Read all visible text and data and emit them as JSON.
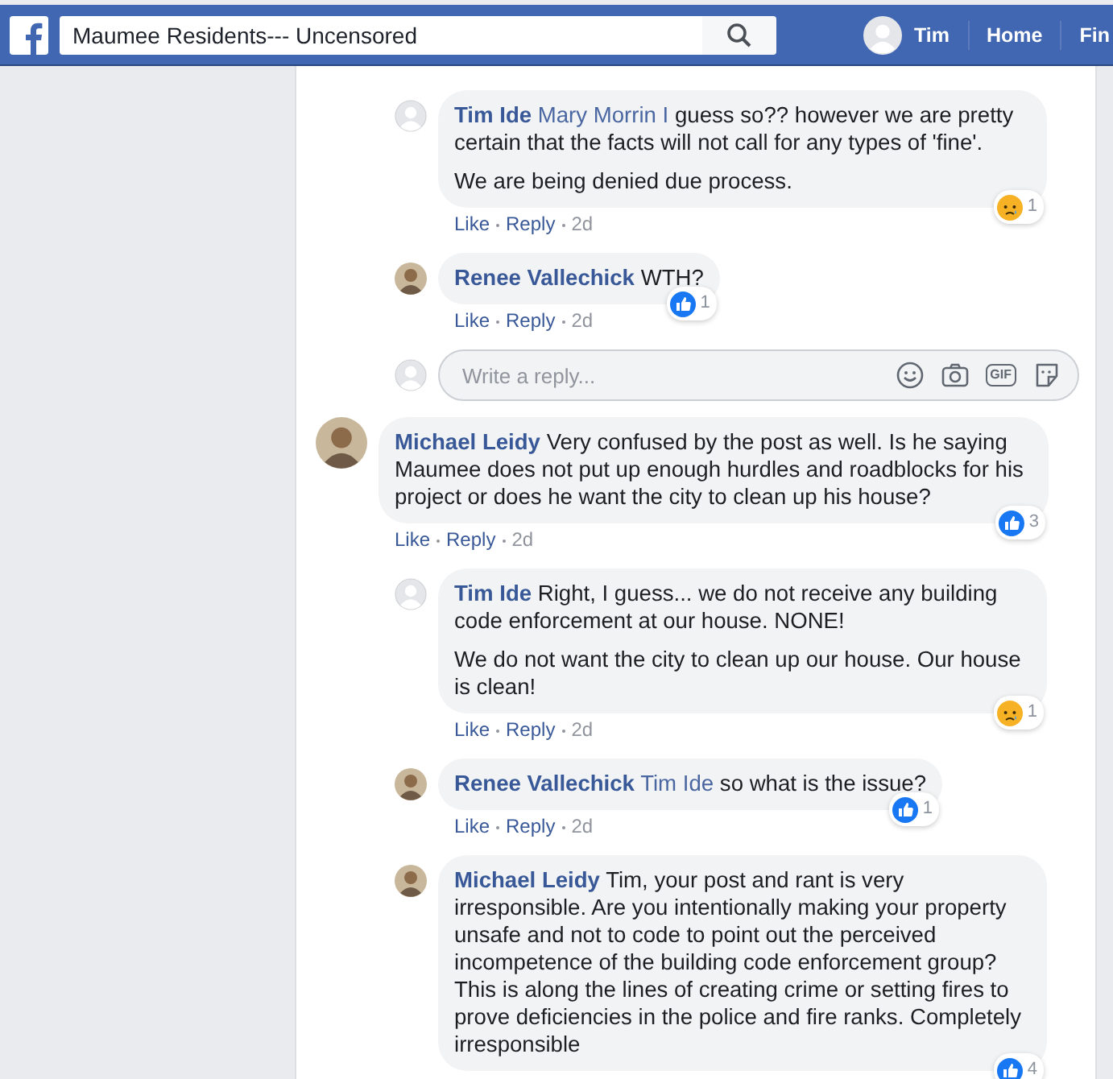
{
  "top_bar": {
    "search": {
      "value": "Maumee Residents--- Uncensored"
    },
    "user": "Tim",
    "nav": [
      "Home",
      "Fin"
    ]
  },
  "threads": [
    {
      "replies": [
        {
          "author": "Tim Ide",
          "has_photo": false,
          "mention": "Mary Morrin I",
          "paragraphs": [
            "guess so?? however we are pretty certain that the facts will not call for any types of 'fine'.",
            "We are being denied due process."
          ],
          "reaction": {
            "kind": "sad",
            "count": "1"
          },
          "meta": {
            "like": "Like",
            "reply": "Reply",
            "time": "2d"
          }
        },
        {
          "author": "Renee Vallechick",
          "has_photo": true,
          "paragraphs": [
            "WTH?"
          ],
          "reaction": {
            "kind": "like",
            "count": "1"
          },
          "meta": {
            "like": "Like",
            "reply": "Reply",
            "time": "2d"
          }
        }
      ],
      "reply_box": {
        "placeholder": "Write a reply...",
        "gif": "GIF"
      }
    },
    {
      "comment": {
        "author": "Michael Leidy",
        "has_photo": true,
        "paragraphs": [
          "Very confused by the post as well. Is he saying Maumee does not put up enough hurdles and roadblocks for his project or does he want the city to clean up his house?"
        ],
        "reaction": {
          "kind": "like",
          "count": "3"
        },
        "meta": {
          "like": "Like",
          "reply": "Reply",
          "time": "2d"
        }
      },
      "replies": [
        {
          "author": "Tim Ide",
          "has_photo": false,
          "paragraphs": [
            "Right, I guess... we do not receive any building code enforcement at our house. NONE!",
            "We do not want the city to clean up our house. Our house is clean!"
          ],
          "reaction": {
            "kind": "sad",
            "count": "1"
          },
          "meta": {
            "like": "Like",
            "reply": "Reply",
            "time": "2d"
          }
        },
        {
          "author": "Renee Vallechick",
          "has_photo": true,
          "mention": "Tim Ide",
          "paragraphs": [
            "so what is the issue?"
          ],
          "reaction": {
            "kind": "like",
            "count": "1"
          },
          "meta": {
            "like": "Like",
            "reply": "Reply",
            "time": "2d"
          }
        },
        {
          "author": "Michael Leidy",
          "has_photo": true,
          "paragraphs": [
            "Tim, your post and rant is very irresponsible. Are you intentionally making your property unsafe and not to code to point out the perceived incompetence of the building code enforcement group? This is along the lines of creating crime or setting fires to prove deficiencies in the police and fire ranks. Completely irresponsible"
          ],
          "reaction": {
            "kind": "like",
            "count": "4"
          }
        }
      ]
    }
  ]
}
